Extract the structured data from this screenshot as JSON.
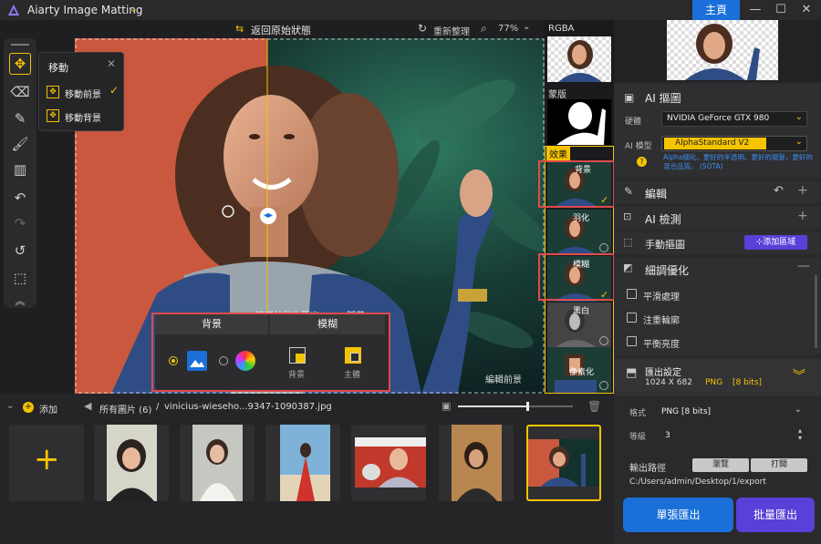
{
  "app": {
    "title": "Aiarty Image Matting",
    "home_label": "主頁"
  },
  "window_controls": [
    "—",
    "☐",
    "✕"
  ],
  "topbar": {
    "reset_label": "返回原始狀態",
    "refresh_label": "重新整理",
    "zoom": "77%"
  },
  "move_popup": {
    "title": "移動",
    "items": [
      "移動前景",
      "移動背景"
    ]
  },
  "canvas": {
    "apply_label": "適用於批次匯出",
    "hide_label": "隱藏",
    "edit_fg_label": "編輯前景"
  },
  "bg_panel": {
    "bg_header": "背景",
    "blur_header": "模糊",
    "blur_items": [
      "背景",
      "主體"
    ]
  },
  "strip": {
    "rgba_label": "RGBA",
    "mask_label": "蒙版",
    "effects_label": "效果",
    "effects": [
      "背景",
      "羽化",
      "模糊",
      "黑白",
      "像素化"
    ]
  },
  "rpanel": {
    "ai_cutout_title": "AI 摳圖",
    "hardware_label": "硬體",
    "hardware_value": "NVIDIA GeForce GTX 980",
    "model_label": "AI 模型",
    "model_value": "AlphaStandard  V2",
    "model_desc": "Alpha細化。更好的半透明。更好的頭髮，更好的混合品質。 (SOTA)",
    "edit_title": "編輯",
    "ai_detect_title": "AI 檢測",
    "manual_title": "手動摳圖",
    "add_area_label": "添加區域",
    "refine_title": "細調優化",
    "refine_opts": [
      "平滑處理",
      "注重輪廓",
      "平衡亮度"
    ],
    "export_title": "匯出設定",
    "export_info": "1024 X 682",
    "export_format_tag": "PNG",
    "export_bits_tag": "[8 bits]",
    "format_label": "格式",
    "format_value": "PNG   [8 bits]",
    "grade_label": "等級",
    "grade_value": "3",
    "outpath_label": "輸出路徑",
    "browse_label": "瀏覽",
    "open_label": "打開",
    "outpath_value": "C:/Users/admin/Desktop/1/export",
    "single_export": "單張匯出",
    "batch_export": "批量匯出"
  },
  "gallery": {
    "add_label": "添加",
    "breadcrumb_all": "所有圖片 (6)",
    "breadcrumb_sep": "/",
    "breadcrumb_file": "vinicius-wieseho...9347-1090387.jpg",
    "zoom_fraction": 0.6
  },
  "colors": {
    "accent_yellow": "#f5c400",
    "accent_blue": "#1a6fd8",
    "red_highlight": "#e04b4b"
  }
}
